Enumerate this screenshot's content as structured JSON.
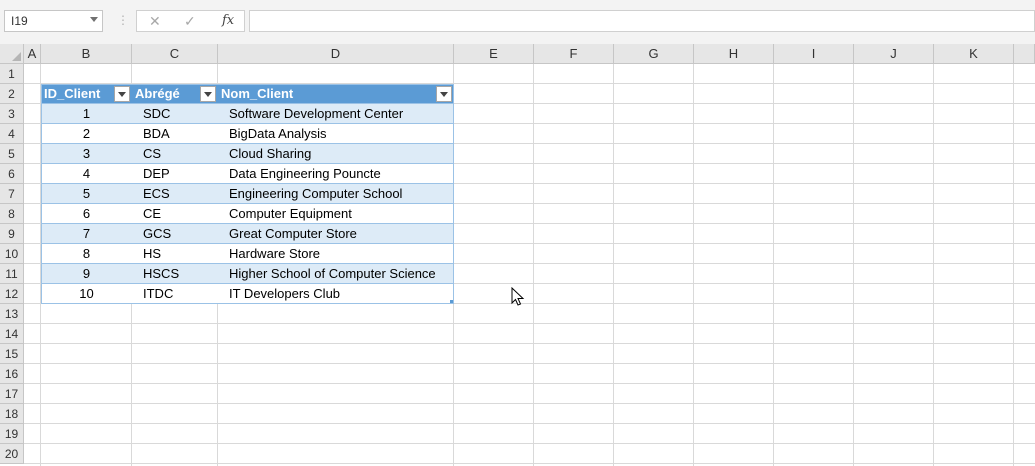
{
  "namebox": {
    "value": "I19"
  },
  "formula_bar": {
    "cancel_icon": "✕",
    "enter_icon": "✓",
    "fx_label": "fx",
    "content": ""
  },
  "columns": [
    "A",
    "B",
    "C",
    "D",
    "E",
    "F",
    "G",
    "H",
    "I",
    "J",
    "K"
  ],
  "rows": [
    "1",
    "2",
    "3",
    "4",
    "5",
    "6",
    "7",
    "8",
    "9",
    "10",
    "11",
    "12",
    "13",
    "14",
    "15",
    "16",
    "17",
    "18",
    "19",
    "20"
  ],
  "table": {
    "headers": [
      "ID_Client",
      "Abrégé",
      "Nom_Client"
    ],
    "rows": [
      [
        "1",
        "SDC",
        "Software Development Center"
      ],
      [
        "2",
        "BDA",
        "BigData Analysis"
      ],
      [
        "3",
        "CS",
        "Cloud Sharing"
      ],
      [
        "4",
        "DEP",
        "Data Engineering Pouncte"
      ],
      [
        "5",
        "ECS",
        "Engineering Computer School"
      ],
      [
        "6",
        "CE",
        "Computer Equipment"
      ],
      [
        "7",
        "GCS",
        "Great Computer Store"
      ],
      [
        "8",
        "HS",
        "Hardware Store"
      ],
      [
        "9",
        "HSCS",
        "Higher School of Computer Science"
      ],
      [
        "10",
        "ITDC",
        "IT Developers Club"
      ]
    ]
  },
  "colors": {
    "table_header": "#5b9bd5",
    "band": "#ddebf7",
    "border": "#9bc2e6"
  }
}
